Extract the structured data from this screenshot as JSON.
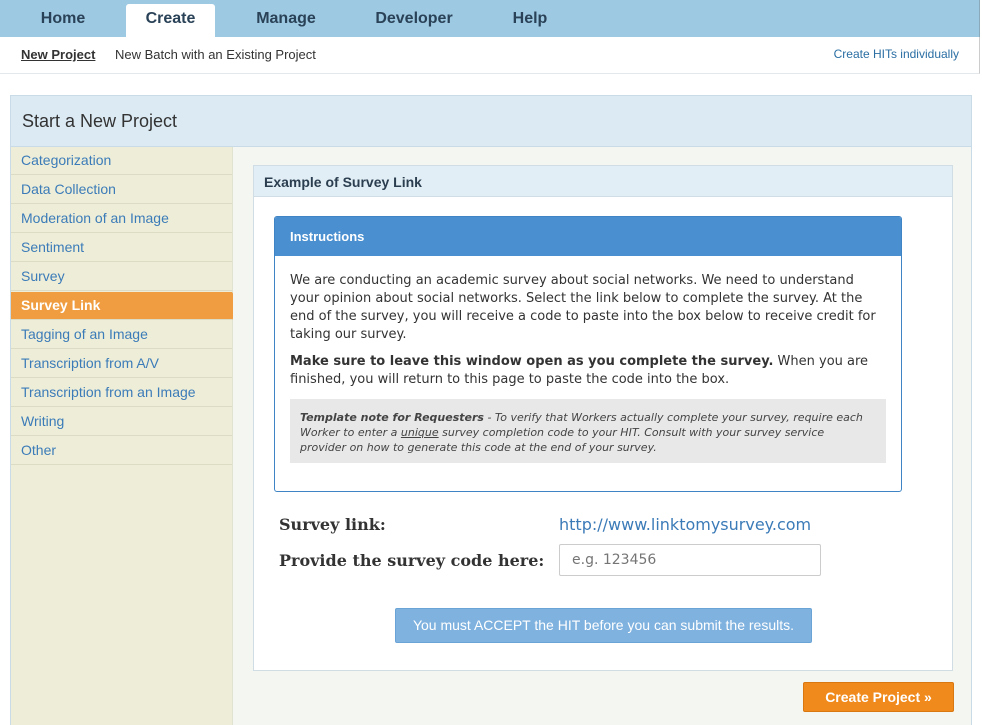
{
  "tabs": [
    "Home",
    "Create",
    "Manage",
    "Developer",
    "Help"
  ],
  "active_tab": "Create",
  "subnav": {
    "new_project": "New Project",
    "new_batch": "New Batch with an Existing Project",
    "create_hits": "Create HITs individually"
  },
  "panel": {
    "title": "Start a New Project"
  },
  "sidebar": {
    "items": [
      "Categorization",
      "Data Collection",
      "Moderation of an Image",
      "Sentiment",
      "Survey",
      "Survey Link",
      "Tagging of an Image",
      "Transcription from A/V",
      "Transcription from an Image",
      "Writing",
      "Other"
    ],
    "active": "Survey Link"
  },
  "example": {
    "title": "Example of Survey Link",
    "instructions_title": "Instructions",
    "para1": "We are conducting an academic survey about social networks. We need to understand your opinion about social networks. Select the link below to complete the survey. At the end of the survey, you will receive a code to paste into the box below to receive credit for taking our survey.",
    "para2_bold": "Make sure to leave this window open as you complete the survey.",
    "para2_rest": " When you are finished, you will return to this page to paste the code into the box.",
    "note_bold": "Template note for Requesters",
    "note_part1": " - To verify that Workers actually complete your survey, require each Worker to enter a ",
    "note_unique": "unique",
    "note_part2": " survey completion code to your HIT. Consult with your survey service provider on how to generate this code at the end of your survey.",
    "survey_link_label": "Survey link:",
    "survey_link_url": "http://www.linktomysurvey.com",
    "code_label": "Provide the survey code here:",
    "code_placeholder": "e.g. 123456",
    "accept_button": "You must ACCEPT the HIT before you can submit the results."
  },
  "create_button": "Create Project »"
}
